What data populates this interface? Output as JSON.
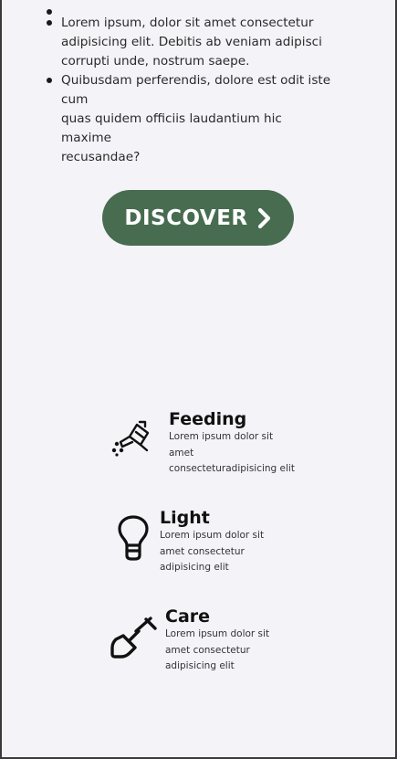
{
  "bullet_list": {
    "items": [
      {
        "lines": []
      },
      {
        "lines": [
          "Lorem ipsum, dolor sit amet consectetur",
          "adipisicing elit. Debitis ab veniam adipisci",
          "corrupti unde, nostrum saepe."
        ]
      },
      {
        "lines": [
          "Quibusdam perferendis, dolore est odit iste cum",
          "quas quidem officiis laudantium hic maxime",
          "recusandae?"
        ]
      }
    ]
  },
  "discover_button": {
    "label": "DISCOVER",
    "icon": "chevron-right-icon",
    "background": "#476c50",
    "text_color": "#ffffff"
  },
  "features": [
    {
      "title": "Feeding",
      "icon": "watering-can-icon",
      "desc_lines": [
        "Lorem ipsum dolor sit",
        "amet",
        "consecteturadipisicing elit"
      ]
    },
    {
      "title": "Light",
      "icon": "light-bulb-icon",
      "desc_lines": [
        "Lorem ipsum dolor sit",
        "amet consectetur",
        "adipisicing elit"
      ]
    },
    {
      "title": "Care",
      "icon": "shovel-icon",
      "desc_lines": [
        "Lorem ipsum dolor sit",
        "amet consectetur",
        "adipisicing elit"
      ]
    }
  ],
  "colors": {
    "page_background": "#f4f3f8",
    "accent_green": "#476c50"
  }
}
